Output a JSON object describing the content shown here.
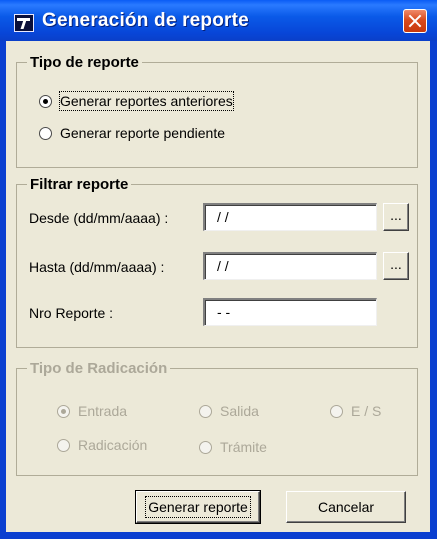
{
  "window": {
    "title": "Generación de reporte"
  },
  "tipo_reporte": {
    "title": "Tipo de reporte",
    "options": [
      {
        "label": "Generar reportes anteriores",
        "checked": true
      },
      {
        "label": "Generar reporte pendiente",
        "checked": false
      }
    ]
  },
  "filtrar": {
    "title": "Filtrar reporte",
    "desde": {
      "label": "Desde (dd/mm/aaaa) :",
      "value": " / /",
      "button": "..."
    },
    "hasta": {
      "label": "Hasta (dd/mm/aaaa) :",
      "value": " / /",
      "button": "..."
    },
    "nro": {
      "label": "Nro Reporte :",
      "value": " - -"
    }
  },
  "radicacion": {
    "title": "Tipo de Radicación",
    "enabled": false,
    "options": [
      {
        "label": "Entrada",
        "checked": true
      },
      {
        "label": "Salida",
        "checked": false
      },
      {
        "label": "E / S",
        "checked": false
      },
      {
        "label": "Radicación",
        "checked": false
      },
      {
        "label": "Trámite",
        "checked": false
      }
    ]
  },
  "buttons": {
    "generar": "Generar reporte",
    "cancelar": "Cancelar"
  },
  "colors": {
    "titlebar": "#0a5ae8",
    "close": "#d84a1e",
    "face": "#ece9d8",
    "disabled_text": "#aca899"
  },
  "icons": {
    "app": "app-icon",
    "close": "close-icon"
  }
}
